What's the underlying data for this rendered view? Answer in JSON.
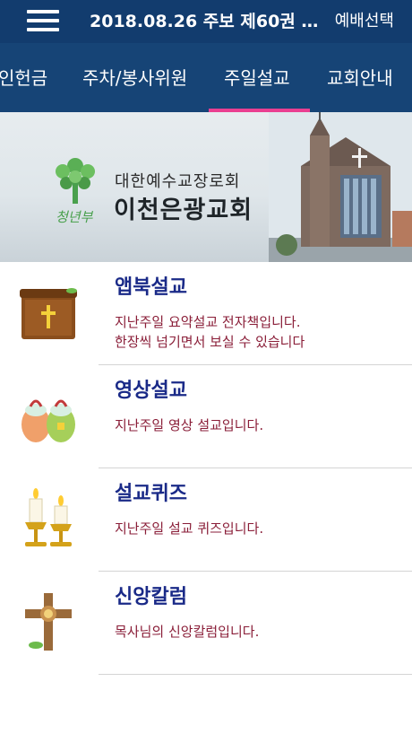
{
  "header": {
    "title": "2018.08.26 주보 제60권 3...",
    "service_select_label": "예배선택"
  },
  "tabs": [
    {
      "label": "인헌금"
    },
    {
      "label": "주차/봉사위원"
    },
    {
      "label": "주일설교"
    },
    {
      "label": "교회안내"
    }
  ],
  "active_tab": "주일설교",
  "banner": {
    "church_name_small": "대한예수교장로회",
    "church_name_large": "이천은광교회",
    "logo_text": "청년부"
  },
  "items": [
    {
      "title": "앱북설교",
      "desc_line1": "지난주일 요약설교 전자책입니다.",
      "desc_line2": "한장씩 넘기면서 보실 수 있습니다",
      "icon": "bible-box-icon"
    },
    {
      "title": "영상설교",
      "desc_line1": "지난주일 영상 설교입니다.",
      "desc_line2": "",
      "icon": "gift-bags-icon"
    },
    {
      "title": "설교퀴즈",
      "desc_line1": "지난주일 설교 퀴즈입니다.",
      "desc_line2": "",
      "icon": "candles-icon"
    },
    {
      "title": "신앙칼럼",
      "desc_line1": "목사님의 신앙칼럼입니다.",
      "desc_line2": "",
      "icon": "cross-icon"
    }
  ],
  "colors": {
    "header_bg": "#123c6e",
    "tab_bg": "#164476",
    "tab_active_underline": "#ea3f91",
    "item_title": "#1a2a88",
    "item_desc": "#8a1e38"
  }
}
